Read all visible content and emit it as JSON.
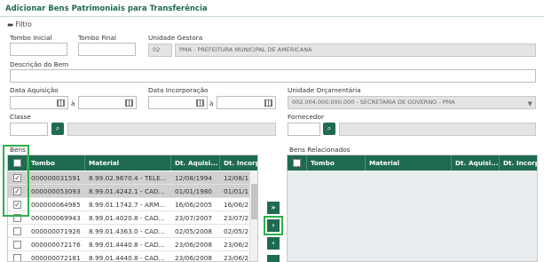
{
  "page": {
    "title": "Adicionar Bens Patrimoniais para Transferência",
    "filter_label": "Filtro"
  },
  "filters": {
    "tombo_inicial_label": "Tombo Inicial",
    "tombo_final_label": "Tombo Final",
    "unidade_gestora_label": "Unidade Gestora",
    "unidade_gestora_code": "02",
    "unidade_gestora_name": "PMA - PREFEITURA MUNICIPAL DE AMERICANA",
    "descricao_label": "Descrição do Bem",
    "data_aquisicao_label": "Data Aquisição",
    "data_incorporacao_label": "Data Incorporação",
    "range_sep": "à",
    "unidade_orcamentaria_label": "Unidade Orçamentária",
    "unidade_orcamentaria_value": "002.004.000.000.000 - SECRETARIA DE GOVERNO - PMA",
    "classe_label": "Classe",
    "fornecedor_label": "Fornecedor"
  },
  "bens": {
    "label": "Bens",
    "columns": [
      "Tombo",
      "Material",
      "Dt. Aquisi...",
      "Dt. Incorp."
    ],
    "rows": [
      {
        "tombo": "000000031591",
        "material": "8.99.02.9670.4 - TELE...",
        "dt_aquisicao": "12/08/1994",
        "dt_incorp": "12/08/1",
        "checked": true,
        "selected": true
      },
      {
        "tombo": "000000053093",
        "material": "8.99.01.4242.1 - CAD...",
        "dt_aquisicao": "01/01/1980",
        "dt_incorp": "01/01/1",
        "checked": true,
        "selected": true
      },
      {
        "tombo": "000000064985",
        "material": "8.99.01.1742.7 - ARM...",
        "dt_aquisicao": "16/06/2005",
        "dt_incorp": "16/06/2",
        "checked": true,
        "selected": false
      },
      {
        "tombo": "000000069943",
        "material": "8.99.01.4020.8 - CAD...",
        "dt_aquisicao": "23/07/2007",
        "dt_incorp": "23/07/2",
        "checked": false,
        "selected": false
      },
      {
        "tombo": "000000071926",
        "material": "8.99.01.4363.0 - CAD...",
        "dt_aquisicao": "02/05/2008",
        "dt_incorp": "02/05/2",
        "checked": false,
        "selected": false
      },
      {
        "tombo": "000000072176",
        "material": "8.99.01.4440.8 - CAD...",
        "dt_aquisicao": "23/06/2008",
        "dt_incorp": "23/06/2",
        "checked": false,
        "selected": false
      },
      {
        "tombo": "000000072181",
        "material": "8.99.01.4440.8 - CAD...",
        "dt_aquisicao": "23/06/2008",
        "dt_incorp": "23/06/2",
        "checked": false,
        "selected": false
      }
    ]
  },
  "relacionados": {
    "label": "Bens Relacionados",
    "columns": [
      "Tombo",
      "Material",
      "Dt. Aquisi...",
      "Dt. Incorp."
    ]
  },
  "move_buttons": {
    "move_all": "»",
    "move_one": "›",
    "remove_one": "‹"
  }
}
